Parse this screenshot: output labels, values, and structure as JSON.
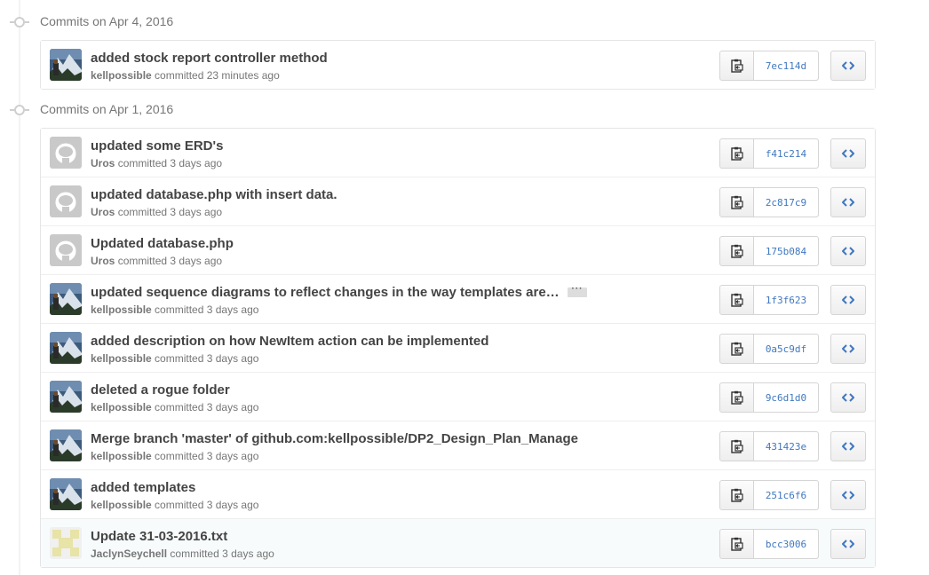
{
  "groups": [
    {
      "title": "Commits on Apr 4, 2016",
      "commits": [
        {
          "message": "added stock report controller method",
          "author": "kellpossible",
          "time": "committed 23 minutes ago",
          "sha": "7ec114d",
          "avatar": "mountain-avatar"
        }
      ]
    },
    {
      "title": "Commits on Apr 1, 2016",
      "commits": [
        {
          "message": "updated some ERD's",
          "author": "Uros",
          "time": "committed 3 days ago",
          "sha": "f41c214",
          "avatar": "octocat-avatar"
        },
        {
          "message": "updated database.php with insert data.",
          "author": "Uros",
          "time": "committed 3 days ago",
          "sha": "2c817c9",
          "avatar": "octocat-avatar"
        },
        {
          "message": "Updated database.php",
          "author": "Uros",
          "time": "committed 3 days ago",
          "sha": "175b084",
          "avatar": "octocat-avatar"
        },
        {
          "message": "updated sequence diagrams to reflect changes in the way templates are…",
          "author": "kellpossible",
          "time": "committed 3 days ago",
          "sha": "1f3f623",
          "avatar": "mountain-avatar",
          "ellipsis": "···"
        },
        {
          "message": "added description on how NewItem action can be implemented",
          "author": "kellpossible",
          "time": "committed 3 days ago",
          "sha": "0a5c9df",
          "avatar": "mountain-avatar"
        },
        {
          "message": "deleted a rogue folder",
          "author": "kellpossible",
          "time": "committed 3 days ago",
          "sha": "9c6d1d0",
          "avatar": "mountain-avatar"
        },
        {
          "message": "Merge branch 'master' of github.com:kellpossible/DP2_Design_Plan_Manage",
          "author": "kellpossible",
          "time": "committed 3 days ago",
          "sha": "431423e",
          "avatar": "mountain-avatar"
        },
        {
          "message": "added templates",
          "author": "kellpossible",
          "time": "committed 3 days ago",
          "sha": "251c6f6",
          "avatar": "mountain-avatar"
        },
        {
          "message": "Update 31-03-2016.txt",
          "author": "JaclynSeychell",
          "time": "committed 3 days ago",
          "sha": "bcc3006",
          "avatar": "identicon-avatar"
        }
      ]
    }
  ],
  "colors": {
    "sha": "#4078c0",
    "meta": "#767676",
    "message": "#444444",
    "identicon": "#e8e3a6"
  },
  "icons": {
    "copy": "clipboard-icon",
    "browse": "code-icon",
    "group": "git-commit-icon"
  }
}
